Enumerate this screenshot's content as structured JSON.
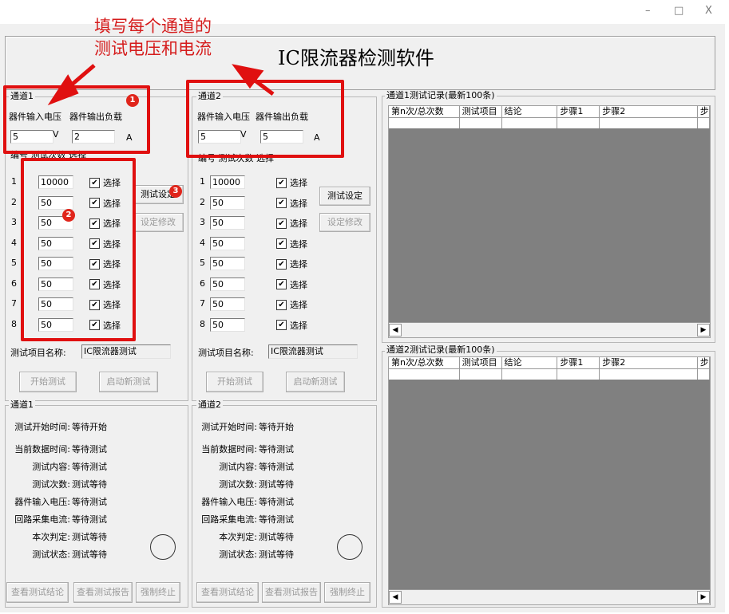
{
  "window_controls": {
    "minimize": "–",
    "maximize": "□",
    "close": "X"
  },
  "app": {
    "title": "IC限流器检测软件"
  },
  "annotation": {
    "line1": "填写每个通道的",
    "line2": "测试电压和电流",
    "badge1": "1",
    "badge2": "2",
    "badge3": "3"
  },
  "channel1": {
    "title": "通道1",
    "voltage_label": "器件输入电压",
    "load_label": "器件输出负载",
    "voltage_value": "5",
    "voltage_unit": "V",
    "load_value": "2",
    "load_unit": "A",
    "list_header": "编号 测试次数 选择",
    "rows": [
      {
        "num": "1",
        "count": "10000",
        "check": "选择"
      },
      {
        "num": "2",
        "count": "50",
        "check": "选择"
      },
      {
        "num": "3",
        "count": "50",
        "check": "选择"
      },
      {
        "num": "4",
        "count": "50",
        "check": "选择"
      },
      {
        "num": "5",
        "count": "50",
        "check": "选择"
      },
      {
        "num": "6",
        "count": "50",
        "check": "选择"
      },
      {
        "num": "7",
        "count": "50",
        "check": "选择"
      },
      {
        "num": "8",
        "count": "50",
        "check": "选择"
      }
    ],
    "btn_setting": "测试设定",
    "btn_modify": "设定修改",
    "test_name_label": "测试项目名称:",
    "test_name_value": "IC限流器测试",
    "btn_start": "开始测试",
    "btn_new": "启动新测试"
  },
  "channel2": {
    "title": "通道2",
    "voltage_label": "器件输入电压",
    "load_label": "器件输出负载",
    "voltage_value": "5",
    "voltage_unit": "V",
    "load_value": "5",
    "load_unit": "A",
    "list_header": "编号 测试次数 选择",
    "rows": [
      {
        "num": "1",
        "count": "10000",
        "check": "选择"
      },
      {
        "num": "2",
        "count": "50",
        "check": "选择"
      },
      {
        "num": "3",
        "count": "50",
        "check": "选择"
      },
      {
        "num": "4",
        "count": "50",
        "check": "选择"
      },
      {
        "num": "5",
        "count": "50",
        "check": "选择"
      },
      {
        "num": "6",
        "count": "50",
        "check": "选择"
      },
      {
        "num": "7",
        "count": "50",
        "check": "选择"
      },
      {
        "num": "8",
        "count": "50",
        "check": "选择"
      }
    ],
    "btn_setting": "测试设定",
    "btn_modify": "设定修改",
    "test_name_label": "测试项目名称:",
    "test_name_value": "IC限流器测试",
    "btn_start": "开始测试",
    "btn_new": "启动新测试"
  },
  "status1": {
    "title": "通道1",
    "lines": [
      {
        "label": "测试开始时间:",
        "value": "等待开始"
      },
      {
        "label": "当前数据时间:",
        "value": "等待测试"
      },
      {
        "label": "测试内容:",
        "value": "等待测试"
      },
      {
        "label": "测试次数:",
        "value": "测试等待"
      },
      {
        "label": "器件输入电压:",
        "value": "等待测试"
      },
      {
        "label": "回路采集电流:",
        "value": "等待测试"
      },
      {
        "label": "本次判定:",
        "value": "测试等待"
      },
      {
        "label": "测试状态:",
        "value": "测试等待"
      }
    ],
    "btn_result": "查看测试结论",
    "btn_report": "查看测试报告",
    "btn_stop": "强制终止"
  },
  "status2": {
    "title": "通道2",
    "lines": [
      {
        "label": "测试开始时间:",
        "value": "等待开始"
      },
      {
        "label": "当前数据时间:",
        "value": "等待测试"
      },
      {
        "label": "测试内容:",
        "value": "等待测试"
      },
      {
        "label": "测试次数:",
        "value": "测试等待"
      },
      {
        "label": "器件输入电压:",
        "value": "等待测试"
      },
      {
        "label": "回路采集电流:",
        "value": "等待测试"
      },
      {
        "label": "本次判定:",
        "value": "测试等待"
      },
      {
        "label": "测试状态:",
        "value": "测试等待"
      }
    ],
    "btn_result": "查看测试结论",
    "btn_report": "查看测试报告",
    "btn_stop": "强制终止"
  },
  "log1": {
    "title": "通道1测试记录(最新100条)",
    "columns": [
      "第n次/总次数",
      "测试项目",
      "结论",
      "步骤1",
      "步骤2",
      "步"
    ]
  },
  "log2": {
    "title": "通道2测试记录(最新100条)",
    "columns": [
      "第n次/总次数",
      "测试项目",
      "结论",
      "步骤1",
      "步骤2",
      "步"
    ]
  },
  "scroll": {
    "left": "◀",
    "right": "▶"
  }
}
